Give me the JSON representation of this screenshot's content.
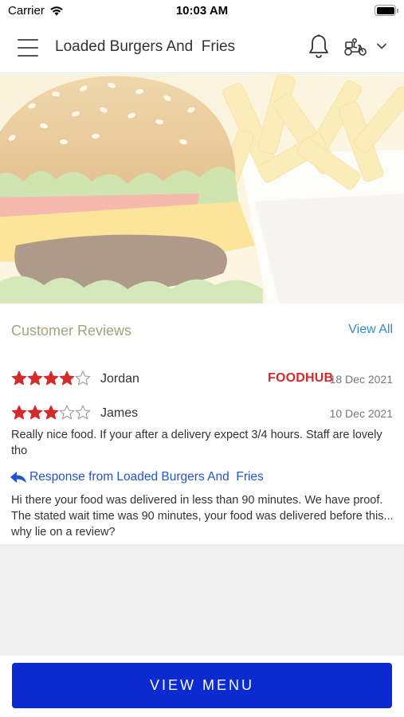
{
  "status_bar": {
    "carrier": "Carrier",
    "time": "10:03 AM",
    "wifi_icon": "wifi-icon",
    "battery_icon": "battery-icon"
  },
  "header": {
    "title": "Loaded Burgers And  Fries",
    "menu_icon": "hamburger-menu-icon",
    "notification_icon": "bell-icon",
    "delivery_icon": "scooter-icon",
    "dropdown_icon": "chevron-down-icon"
  },
  "hero": {
    "image": "burger-and-fries-photo"
  },
  "reviews": {
    "section_title": "Customer Reviews",
    "view_all_label": "View All",
    "items": [
      {
        "reviewer": "Jordan",
        "rating": 4,
        "max_rating": 5,
        "source": "FOODHUB",
        "date": "18 Dec 2021"
      },
      {
        "reviewer": "James",
        "rating": 3,
        "max_rating": 5,
        "date": "10 Dec 2021",
        "text": "Really nice food. If your after a delivery expect 3/4 hours. Staff are lovely tho",
        "response_label": "Response from Loaded Burgers And  Fries",
        "response_text": "Hi there your food was delivered in less than 90 minutes. We have proof. The stated wait time was 90 minutes, your food was delivered before this... why lie on a review?"
      }
    ]
  },
  "footer": {
    "view_menu_label": "VIEW MENU"
  },
  "colors": {
    "accent_button": "#0b2bd1",
    "star": "#d42a2a",
    "link": "#2a8fc9",
    "section_title": "#a89f7c",
    "foodhub": "#d42a2a"
  }
}
